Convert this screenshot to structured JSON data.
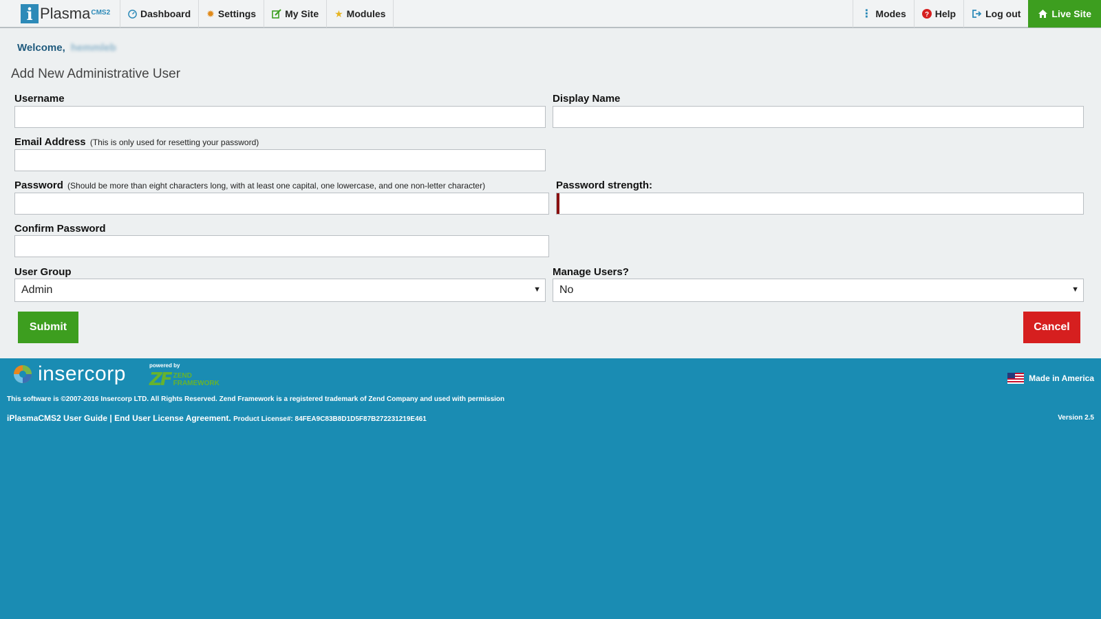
{
  "brand": {
    "letter": "i",
    "name": "Plasma",
    "sup": "CMS2"
  },
  "nav": {
    "left": [
      {
        "label": "Dashboard",
        "icon": "dashboard-icon"
      },
      {
        "label": "Settings",
        "icon": "gear-icon"
      },
      {
        "label": "My Site",
        "icon": "edit-icon"
      },
      {
        "label": "Modules",
        "icon": "star-icon"
      }
    ],
    "right": [
      {
        "label": "Modes",
        "icon": "vertical-dots-icon"
      },
      {
        "label": "Help",
        "icon": "help-icon"
      },
      {
        "label": "Log out",
        "icon": "logout-icon"
      },
      {
        "label": "Live Site",
        "icon": "home-icon"
      }
    ]
  },
  "welcome": {
    "prefix": "Welcome,",
    "username": "hemmleb"
  },
  "page": {
    "title": "Add New Administrative User"
  },
  "form": {
    "username": {
      "label": "Username",
      "value": ""
    },
    "display_name": {
      "label": "Display Name",
      "value": ""
    },
    "email": {
      "label": "Email Address",
      "note": "(This is only used for resetting your password)",
      "value": ""
    },
    "password": {
      "label": "Password",
      "note": "(Should be more than eight characters long, with at least one capital, one lowercase, and one non-letter character)",
      "value": ""
    },
    "password_strength": {
      "label": "Password strength:"
    },
    "confirm_password": {
      "label": "Confirm Password",
      "value": ""
    },
    "user_group": {
      "label": "User Group",
      "selected": "Admin"
    },
    "manage_users": {
      "label": "Manage Users?",
      "selected": "No"
    },
    "submit_label": "Submit",
    "cancel_label": "Cancel"
  },
  "footer": {
    "company": "insercorp",
    "powered_by": "powered by",
    "zend_words_1": "ZEND",
    "zend_words_2": "FRAMEWORK",
    "made_in": "Made in America",
    "copyright": "This software is ©2007-2016 Insercorp LTD. All Rights Reserved. Zend Framework is a registered trademark of Zend Company and used with permission",
    "guide_link": "iPlasmaCMS2 User Guide",
    "separator": " | ",
    "eula_link": "End User License Agreement.",
    "license": "Product License#: 84FEA9C83B8D1D5F87B272231219E461",
    "version": "Version 2.5"
  },
  "colors": {
    "nav_bg": "#f1f3f4",
    "content_bg": "#edf0f1",
    "footer_bg": "#1a8cb3",
    "green": "#3d9e1f",
    "red": "#d61f1f"
  }
}
